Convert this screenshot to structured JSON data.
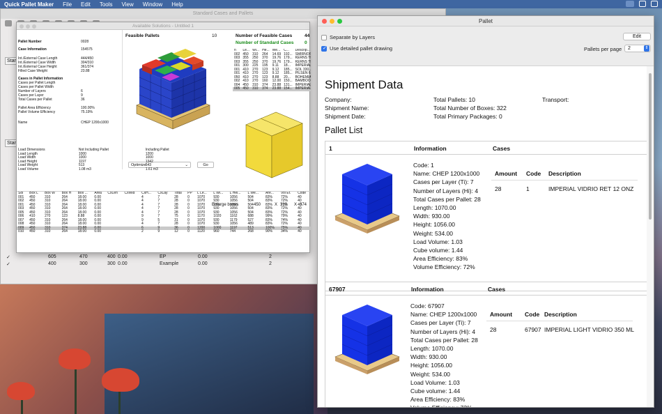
{
  "menubar": {
    "app": "Quick Pallet Maker",
    "items": [
      "File",
      "Edit",
      "Tools",
      "View",
      "Window",
      "Help"
    ]
  },
  "bg_window": {
    "title": "Standard Cases and Pallets",
    "tab1": "Stan",
    "tab2": "Stan",
    "rows": [
      [
        "✓",
        "605",
        "470",
        "400",
        "0.00",
        "EP",
        "0.00",
        "2"
      ],
      [
        "✓",
        "400",
        "300",
        "300",
        "0.00",
        "Example",
        "0.00",
        "2"
      ]
    ]
  },
  "solutions": {
    "title": "Available Solutions - Untitled 1",
    "feasible_label": "Feasible Pallets",
    "feasible_count": "10",
    "num_feasible_label": "Number of Feasible Cases",
    "num_feasible": "44",
    "num_standard_label": "Number of Standard Cases",
    "num_standard": "0",
    "left_info": [
      [
        "Pallet Number",
        "0028"
      ],
      [
        "Case Information",
        "154575"
      ],
      [
        "Int./External Case Length",
        "444/450"
      ],
      [
        "Int./External Case Width",
        "304/310"
      ],
      [
        "Int./External Case Height",
        "361/374"
      ],
      [
        "Filled Case Weight",
        "23.88"
      ],
      [
        "Cases in Pallet Information",
        ""
      ],
      [
        "Cases per Pallet Length",
        ""
      ],
      [
        "Cases per Pallet Width",
        ""
      ],
      [
        "Number of Layers",
        "6"
      ],
      [
        "Cases per Layer",
        "9"
      ],
      [
        "Total Cases per Pallet",
        "36"
      ],
      [
        "Pallet Area Efficiency",
        "100.00%"
      ],
      [
        "Pallet Volume Efficiency",
        "75.19%"
      ],
      [
        "Name",
        "CHEP 1200x1000"
      ]
    ],
    "optimize_label": "Optimize",
    "go_label": "Go",
    "case_table": {
      "headers": [
        "n",
        "Le...",
        "Wi...",
        "He...",
        "We...",
        "C...",
        "Descrip..."
      ],
      "rows": [
        [
          "002",
          "450",
          "310",
          "264",
          "14.69",
          "192...",
          "SMIRNOF..."
        ],
        [
          "003",
          "355",
          "250",
          "370",
          "19.76",
          "179...",
          "KERNS TE..."
        ],
        [
          "003",
          "355",
          "250",
          "370",
          "19.76",
          "179...",
          "KERNS TE..."
        ],
        [
          "001",
          "300",
          "225",
          "195",
          "9.11",
          "18...",
          "IMPERIAL..."
        ],
        [
          "001",
          "410",
          "270",
          "123",
          "9.12",
          "185...",
          "SOL 330..."
        ],
        [
          "001",
          "410",
          "270",
          "123",
          "9.12",
          "185...",
          "PILSEN 6..."
        ],
        [
          "050",
          "410",
          "270",
          "123",
          "8.88",
          "20...",
          "BOHEMIA..."
        ],
        [
          "002",
          "410",
          "270",
          "160",
          "12.00",
          "150...",
          "BAMBOO..."
        ],
        [
          "004",
          "450",
          "310",
          "374",
          "23.88",
          "131...",
          "IMPERIAL..."
        ],
        [
          "005",
          "450",
          "310",
          "374",
          "23.88",
          "154...",
          "IMPERIAL..."
        ]
      ]
    },
    "load": {
      "col1": "Load Dimensions",
      "col2": "Not Including Pallet",
      "col3": "Including Pallet",
      "rows": [
        [
          "Load Length",
          "1000",
          "1200"
        ],
        [
          "Load Width",
          "1000",
          "1000"
        ],
        [
          "Load Height",
          "1197",
          "1342"
        ],
        [
          "Load Weight",
          "513",
          "543"
        ],
        [
          "Load Volume",
          "1.08 m3",
          "1.61 m3"
        ]
      ]
    },
    "enlarge_label": "Enlarge boxes",
    "enlarge_l": "450",
    "x1": "X",
    "enlarge_w": "310",
    "x2": "X",
    "enlarge_h": "374",
    "bottom_table": {
      "headers": [
        "Sol",
        "Box L",
        "Box W",
        "Box H",
        "Box ...",
        "Area",
        "CxLen",
        "CxWid",
        "CxH...",
        "CxLay",
        "Total",
        "PP",
        "L Le...",
        "L Wi...",
        "L Hei...",
        "L We...",
        "Are...",
        "Vol Ef.",
        "Code"
      ],
      "rows": [
        [
          "001",
          "450",
          "310",
          "264",
          "18.00",
          "0.00",
          "",
          "",
          "4",
          "7",
          "28",
          "0",
          "1070",
          "930",
          "1056",
          "504",
          "83%",
          "72%",
          "40"
        ],
        [
          "002",
          "450",
          "310",
          "264",
          "18.00",
          "0.00",
          "",
          "",
          "4",
          "7",
          "28",
          "0",
          "1070",
          "930",
          "1056",
          "504",
          "83%",
          "72%",
          "40"
        ],
        [
          "001",
          "450",
          "310",
          "264",
          "18.00",
          "0.00",
          "",
          "",
          "4",
          "7",
          "28",
          "0",
          "1070",
          "930",
          "1056",
          "504",
          "83%",
          "72%",
          "40"
        ],
        [
          "003",
          "450",
          "310",
          "264",
          "18.00",
          "0.00",
          "",
          "",
          "4",
          "7",
          "28",
          "0",
          "1070",
          "930",
          "1056",
          "504",
          "83%",
          "72%",
          "40"
        ],
        [
          "005",
          "450",
          "310",
          "264",
          "18.00",
          "0.00",
          "",
          "",
          "4",
          "7",
          "28",
          "0",
          "1070",
          "930",
          "1056",
          "504",
          "83%",
          "72%",
          "40"
        ],
        [
          "006",
          "410",
          "270",
          "123",
          "8.88",
          "0.00",
          "",
          "",
          "9",
          "7",
          "75",
          "0",
          "1170",
          "1020",
          "1162",
          "688",
          "99%",
          "79%",
          "40"
        ],
        [
          "007",
          "450",
          "310",
          "264",
          "18.00",
          "0.00",
          "",
          "",
          "9",
          "5",
          "31",
          "0",
          "1070",
          "930",
          "1179",
          "527",
          "83%",
          "74%",
          "40"
        ],
        [
          "008",
          "450",
          "310",
          "264",
          "18.00",
          "0.00",
          "",
          "",
          "4",
          "7",
          "28",
          "0",
          "1070",
          "930",
          "1056",
          "489",
          "83%",
          "72%",
          "40"
        ],
        [
          "009",
          "450",
          "310",
          "374",
          "23.88",
          "0.00",
          "",
          "",
          "6",
          "9",
          "36",
          "0",
          "1200",
          "1000",
          "1197",
          "513",
          "100%",
          "75%",
          "40"
        ],
        [
          "010",
          "450",
          "310",
          "264",
          "18.00",
          "0.00",
          "",
          "",
          "2",
          "9",
          "12",
          "0",
          "1120",
          "960",
          "744",
          "268",
          "90%",
          "34%",
          "40"
        ]
      ]
    }
  },
  "pallet": {
    "title": "Pallet",
    "separate_label": "Separate by Layers",
    "detailed_label": "Use detailed pallet drawing",
    "edit_label": "Edit",
    "per_page_label": "Pallets per page",
    "per_page_value": "2",
    "shipment_title": "Shipment Data",
    "company": "Company:",
    "total_pallets": "Total Pallets: 10",
    "transport": "Transport:",
    "shipment_name": "Shipment Name:",
    "total_boxes": "Total Number of Boxes: 322",
    "shipment_date": "Shipment Date:",
    "total_primary": "Total Primary Packages: 0",
    "pallet_list": "Pallet List",
    "cards": [
      {
        "id": "1",
        "info": "Information",
        "cases": "Cases",
        "lines": [
          "Code: 1",
          "Name: CHEP 1200x1000",
          "Cases per Layer (Ti): 7",
          "Number of Layers (Hi): 4",
          "Total Cases per Pallet: 28",
          "Length: 1070.00",
          "Width: 930.00",
          "Height: 1056.00",
          "Weight: 534.00",
          "Load Volume: 1.03",
          "Cube volume: 1.44",
          "Area Efficiency: 83%",
          "Volume Efficiency: 72%"
        ],
        "th": [
          "Amount",
          "Code",
          "Description"
        ],
        "row": [
          "28",
          "1",
          "IMPERIAL VIDRIO RET 12 ONZ"
        ]
      },
      {
        "id": "67907",
        "info": "Information",
        "cases": "Cases",
        "lines": [
          "Code: 67907",
          "Name: CHEP 1200x1000",
          "Cases per Layer (Ti): 7",
          "Number of Layers (Hi): 4",
          "Total Cases per Pallet: 28",
          "Length: 1070.00",
          "Width: 930.00",
          "Height: 1056.00",
          "Weight: 534.00",
          "Load Volume: 1.03",
          "Cube volume: 1.44",
          "Area Efficiency: 83%",
          "Volume Efficiency: 72%"
        ],
        "th": [
          "Amount",
          "Code",
          "Description"
        ],
        "row": [
          "28",
          "67907",
          "IMPERIAL LIGHT VIDRIO 350 ML"
        ]
      }
    ]
  }
}
